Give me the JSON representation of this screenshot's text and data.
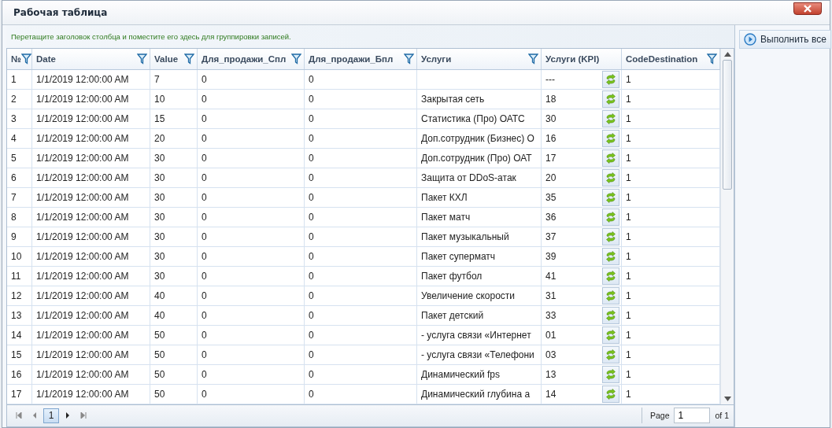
{
  "window": {
    "title": "Рабочая таблица"
  },
  "group_panel": {
    "hint": "Перетащите заголовок столбца и поместите его здесь для группировки записей."
  },
  "table": {
    "columns": [
      {
        "label": "№",
        "filter": true
      },
      {
        "label": "Date",
        "filter": true
      },
      {
        "label": "Value",
        "filter": true
      },
      {
        "label": "Для_продажи_Спл",
        "filter": true
      },
      {
        "label": "Для_продажи_Бпл",
        "filter": true
      },
      {
        "label": "Услуги",
        "filter": true
      },
      {
        "label": "Услуги (KPI)",
        "filter": false
      },
      {
        "label": "CodeDestination",
        "filter": true
      }
    ],
    "rows": [
      {
        "n": "1",
        "date": "1/1/2019 12:00:00 AM",
        "value": "7",
        "spl": "0",
        "bpl": "0",
        "kpi": "---",
        "code": "1"
      },
      {
        "n": "2",
        "date": "1/1/2019 12:00:00 AM",
        "value": "10",
        "spl": "0",
        "bpl": "0",
        "service": "Закрытая сеть",
        "kpi": "18",
        "code": "1"
      },
      {
        "n": "3",
        "date": "1/1/2019 12:00:00 AM",
        "value": "15",
        "spl": "0",
        "bpl": "0",
        "service": "Статистика (Про) ОАТС",
        "kpi": "30",
        "code": "1"
      },
      {
        "n": "4",
        "date": "1/1/2019 12:00:00 AM",
        "value": "20",
        "spl": "0",
        "bpl": "0",
        "service": "Доп.сотрудник (Бизнес) О",
        "kpi": "16",
        "code": "1"
      },
      {
        "n": "5",
        "date": "1/1/2019 12:00:00 AM",
        "value": "30",
        "spl": "0",
        "bpl": "0",
        "service": "Доп.сотрудник (Про) ОАТ",
        "kpi": "17",
        "code": "1"
      },
      {
        "n": "6",
        "date": "1/1/2019 12:00:00 AM",
        "value": "30",
        "spl": "0",
        "bpl": "0",
        "service": "Защита от DDoS-атак",
        "kpi": "20",
        "code": "1"
      },
      {
        "n": "7",
        "date": "1/1/2019 12:00:00 AM",
        "value": "30",
        "spl": "0",
        "bpl": "0",
        "service": "Пакет КХЛ",
        "kpi": "35",
        "code": "1"
      },
      {
        "n": "8",
        "date": "1/1/2019 12:00:00 AM",
        "value": "30",
        "spl": "0",
        "bpl": "0",
        "service": "Пакет матч",
        "kpi": "36",
        "code": "1"
      },
      {
        "n": "9",
        "date": "1/1/2019 12:00:00 AM",
        "value": "30",
        "spl": "0",
        "bpl": "0",
        "service": "Пакет музыкальный",
        "kpi": "37",
        "code": "1"
      },
      {
        "n": "10",
        "date": "1/1/2019 12:00:00 AM",
        "value": "30",
        "spl": "0",
        "bpl": "0",
        "service": "Пакет суперматч",
        "kpi": "39",
        "code": "1"
      },
      {
        "n": "11",
        "date": "1/1/2019 12:00:00 AM",
        "value": "30",
        "spl": "0",
        "bpl": "0",
        "service": "Пакет футбол",
        "kpi": "41",
        "code": "1"
      },
      {
        "n": "12",
        "date": "1/1/2019 12:00:00 AM",
        "value": "40",
        "spl": "0",
        "bpl": "0",
        "service": "Увеличение скорости",
        "kpi": "31",
        "code": "1"
      },
      {
        "n": "13",
        "date": "1/1/2019 12:00:00 AM",
        "value": "40",
        "spl": "0",
        "bpl": "0",
        "service": "Пакет детский",
        "kpi": "33",
        "code": "1"
      },
      {
        "n": "14",
        "date": "1/1/2019 12:00:00 AM",
        "value": "50",
        "spl": "0",
        "bpl": "0",
        "service": "- услуга связи «Интернет",
        "kpi": "01",
        "code": "1"
      },
      {
        "n": "15",
        "date": "1/1/2019 12:00:00 AM",
        "value": "50",
        "spl": "0",
        "bpl": "0",
        "service": "- услуга связи «Телефони",
        "kpi": "03",
        "code": "1"
      },
      {
        "n": "16",
        "date": "1/1/2019 12:00:00 AM",
        "value": "50",
        "spl": "0",
        "bpl": "0",
        "service": "Динамический fps",
        "kpi": "13",
        "code": "1"
      },
      {
        "n": "17",
        "date": "1/1/2019 12:00:00 AM",
        "value": "50",
        "spl": "0",
        "bpl": "0",
        "service": "Динамический глубина а",
        "kpi": "14",
        "code": "1"
      }
    ]
  },
  "pager": {
    "pages": [
      {
        "label": "1",
        "selected": true
      }
    ],
    "page_label": "Page",
    "page_value": "1",
    "of_label": "of 1"
  },
  "side": {
    "button": "Выполнить все"
  }
}
